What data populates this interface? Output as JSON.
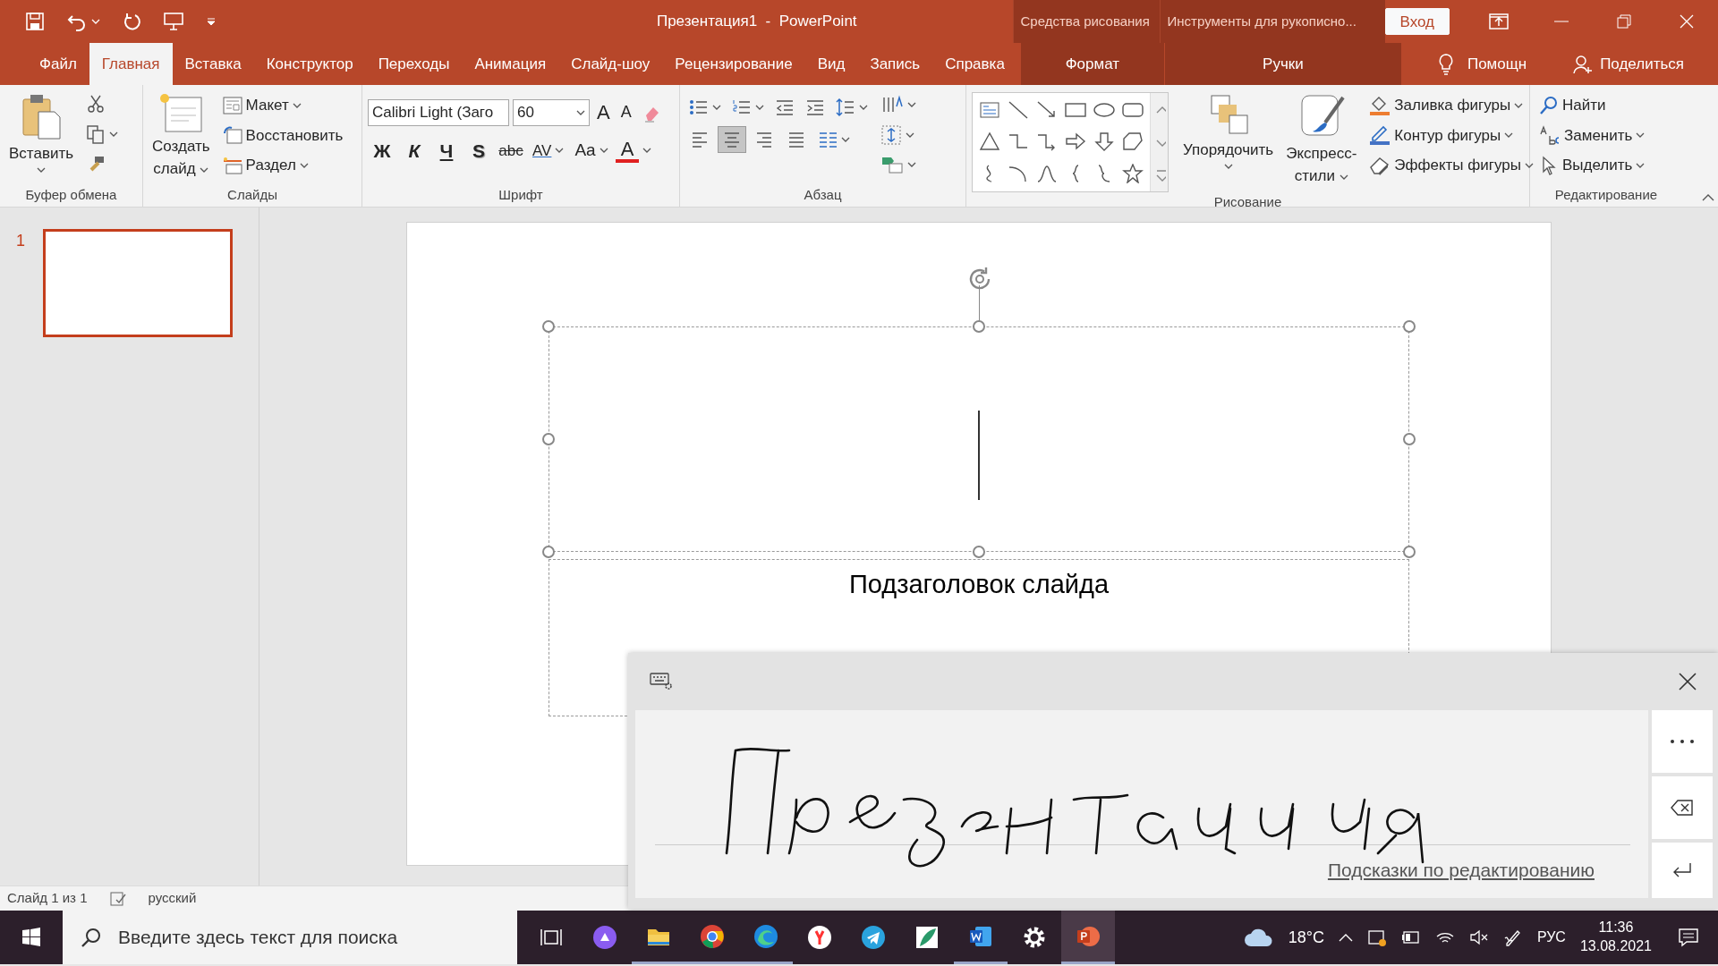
{
  "title_bar": {
    "title": "Презентация1  -  PowerPoint",
    "context_groups": [
      {
        "label": "Средства рисования"
      },
      {
        "label": "Инструменты для рукописно..."
      }
    ],
    "sign_in": "Вход"
  },
  "tabs": [
    {
      "label": "Файл",
      "selected": false,
      "kind": "normal"
    },
    {
      "label": "Главная",
      "selected": true,
      "kind": "normal"
    },
    {
      "label": "Вставка",
      "selected": false,
      "kind": "normal"
    },
    {
      "label": "Конструктор",
      "selected": false,
      "kind": "normal"
    },
    {
      "label": "Переходы",
      "selected": false,
      "kind": "normal"
    },
    {
      "label": "Анимация",
      "selected": false,
      "kind": "normal"
    },
    {
      "label": "Слайд-шоу",
      "selected": false,
      "kind": "normal"
    },
    {
      "label": "Рецензирование",
      "selected": false,
      "kind": "normal"
    },
    {
      "label": "Вид",
      "selected": false,
      "kind": "normal"
    },
    {
      "label": "Запись",
      "selected": false,
      "kind": "normal"
    },
    {
      "label": "Справка",
      "selected": false,
      "kind": "normal"
    },
    {
      "label": "Формат",
      "selected": false,
      "kind": "context"
    },
    {
      "label": "Ручки",
      "selected": false,
      "kind": "context"
    }
  ],
  "tell_me": "Помощн",
  "share": "Поделиться",
  "ribbon": {
    "clipboard": {
      "label": "Буфер обмена",
      "paste": "Вставить"
    },
    "slides": {
      "label": "Слайды",
      "new_slide": [
        "Создать",
        "слайд"
      ],
      "commands": [
        "Макет",
        "Восстановить",
        "Раздел"
      ]
    },
    "font": {
      "label": "Шрифт",
      "font_name": "Calibri Light (Заго",
      "font_size": "60",
      "grow": "A",
      "shrink": "A",
      "format_buttons": [
        "Ж",
        "К",
        "Ч",
        "S",
        "abc"
      ],
      "spacing": "AV",
      "case": "Aa",
      "color_button": "A"
    },
    "paragraph": {
      "label": "Абзац",
      "alignment": [
        {
          "selected": false
        },
        {
          "selected": true
        },
        {
          "selected": false
        },
        {
          "selected": false
        }
      ]
    },
    "drawing": {
      "label": "Рисование",
      "arrange": "Упорядочить",
      "quick_styles": [
        "Экспресс-",
        "стили"
      ],
      "commands": [
        "Заливка фигуры",
        "Контур фигуры",
        "Эффекты фигуры"
      ]
    },
    "editing": {
      "label": "Редактирование",
      "commands": [
        "Найти",
        "Заменить",
        "Выделить"
      ]
    }
  },
  "slides_panel": [
    {
      "number": "1",
      "selected": true
    }
  ],
  "slide": {
    "subtitle": "Подзаголовок слайда"
  },
  "status_bar": {
    "slide_count": "Слайд 1 из 1",
    "language": "русский"
  },
  "handwriting_panel": {
    "hint_link": "Подсказки по редактированию"
  },
  "taskbar": {
    "search_placeholder": "Введите здесь текст для поиска",
    "apps": [
      {
        "running": false,
        "selected": false
      },
      {
        "running": true,
        "selected": false
      },
      {
        "running": true,
        "selected": false
      },
      {
        "running": true,
        "selected": false
      },
      {
        "running": false,
        "selected": false
      },
      {
        "running": false,
        "selected": false
      },
      {
        "running": false,
        "selected": false
      },
      {
        "running": true,
        "selected": false
      },
      {
        "running": false,
        "selected": false
      },
      {
        "running": true,
        "selected": true
      }
    ],
    "weather": "18°C",
    "language": "РУС",
    "time": "11:36",
    "date": "13.08.2021"
  }
}
